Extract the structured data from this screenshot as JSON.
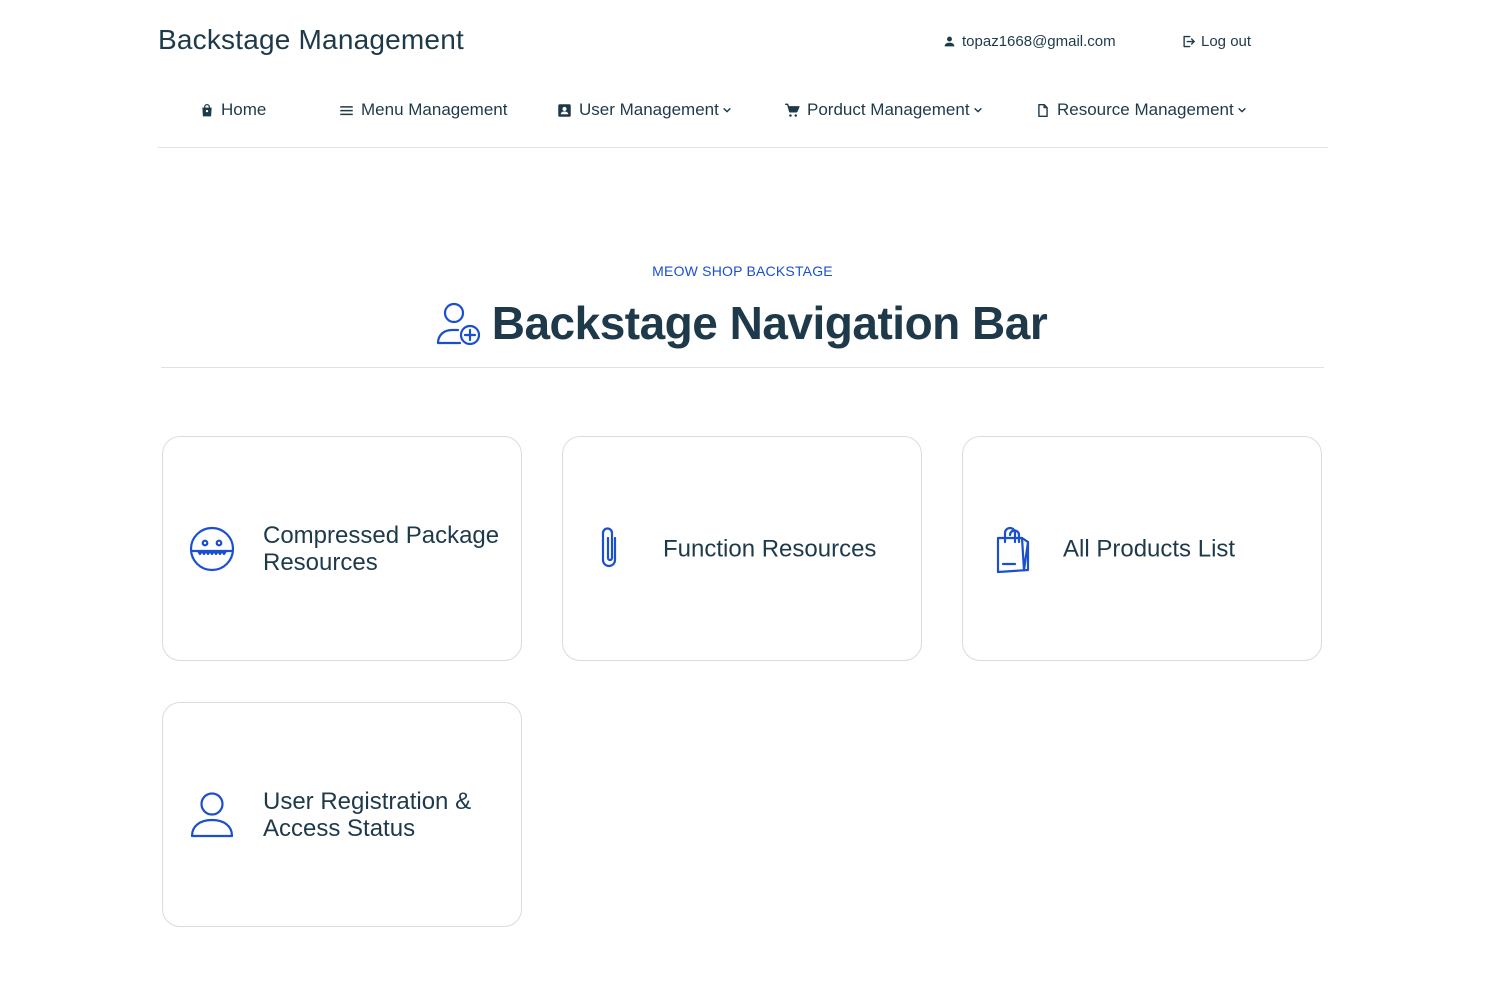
{
  "header": {
    "brand": "Backstage Management",
    "user_email": "topaz1668@gmail.com",
    "logout_label": "Log out"
  },
  "nav": {
    "items": [
      {
        "label": "Home",
        "icon": "shopping-bag-icon"
      },
      {
        "label": "Menu Management",
        "icon": "menu-icon"
      },
      {
        "label": "User Management",
        "icon": "contact-card-icon",
        "dropdown": true
      },
      {
        "label": "Porduct Management",
        "icon": "shopping-cart-icon",
        "dropdown": true
      },
      {
        "label": "Resource Management",
        "icon": "file-icon",
        "dropdown": true
      }
    ]
  },
  "hero": {
    "eyebrow": "MEOW SHOP BACKSTAGE",
    "title": "Backstage Navigation Bar",
    "icon": "user-add-icon"
  },
  "cards": [
    {
      "label": "Compressed Package Resources",
      "icon": "zip-face-icon"
    },
    {
      "label": "Function Resources",
      "icon": "paperclip-icon"
    },
    {
      "label": "All Products List",
      "icon": "shopping-bag-icon"
    },
    {
      "label": "User Registration & Access Status",
      "icon": "user-icon"
    }
  ],
  "colors": {
    "text": "#1e3a4a",
    "accent": "#1a4fd0",
    "border": "#d9dce0"
  }
}
